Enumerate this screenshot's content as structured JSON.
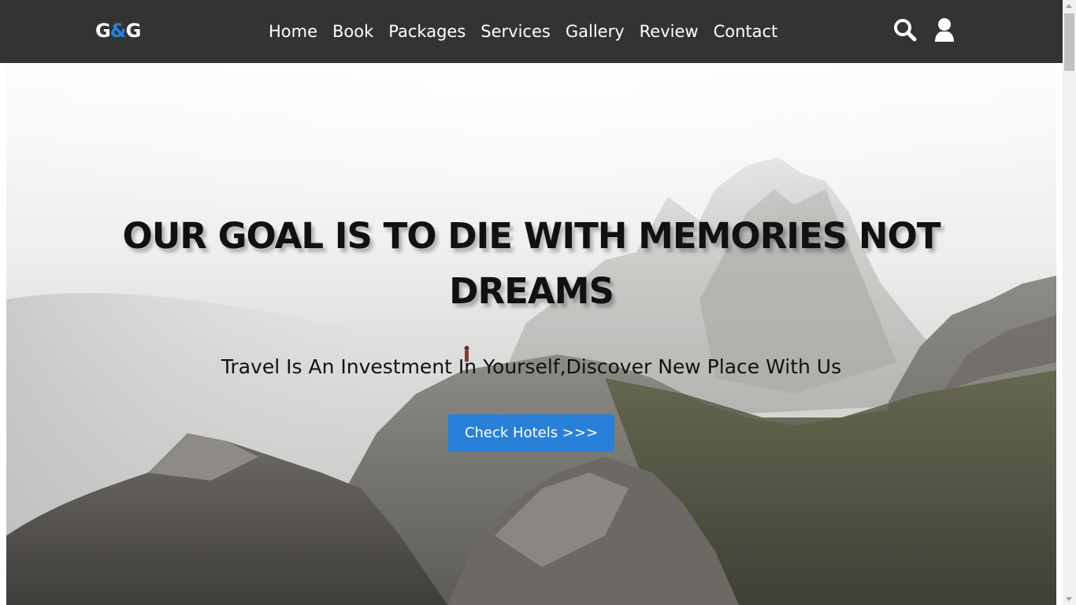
{
  "nav": {
    "logo_part1": "G",
    "logo_amp": "&",
    "logo_part2": "G",
    "links": [
      "Home",
      "Book",
      "Packages",
      "Services",
      "Gallery",
      "Review",
      "Contact"
    ],
    "icons": [
      "search-icon",
      "user-icon"
    ]
  },
  "hero": {
    "title": "OUR GOAL IS TO DIE WITH MEMORIES NOT DREAMS",
    "subtitle": "Travel Is An Investment In Yourself,Discover New Place With Us",
    "button_label": "Check Hotels >>>"
  },
  "colors": {
    "navbar_bg": "#333333",
    "accent": "#2980d9",
    "text_light": "#ffffff",
    "text_dark": "#111111"
  }
}
